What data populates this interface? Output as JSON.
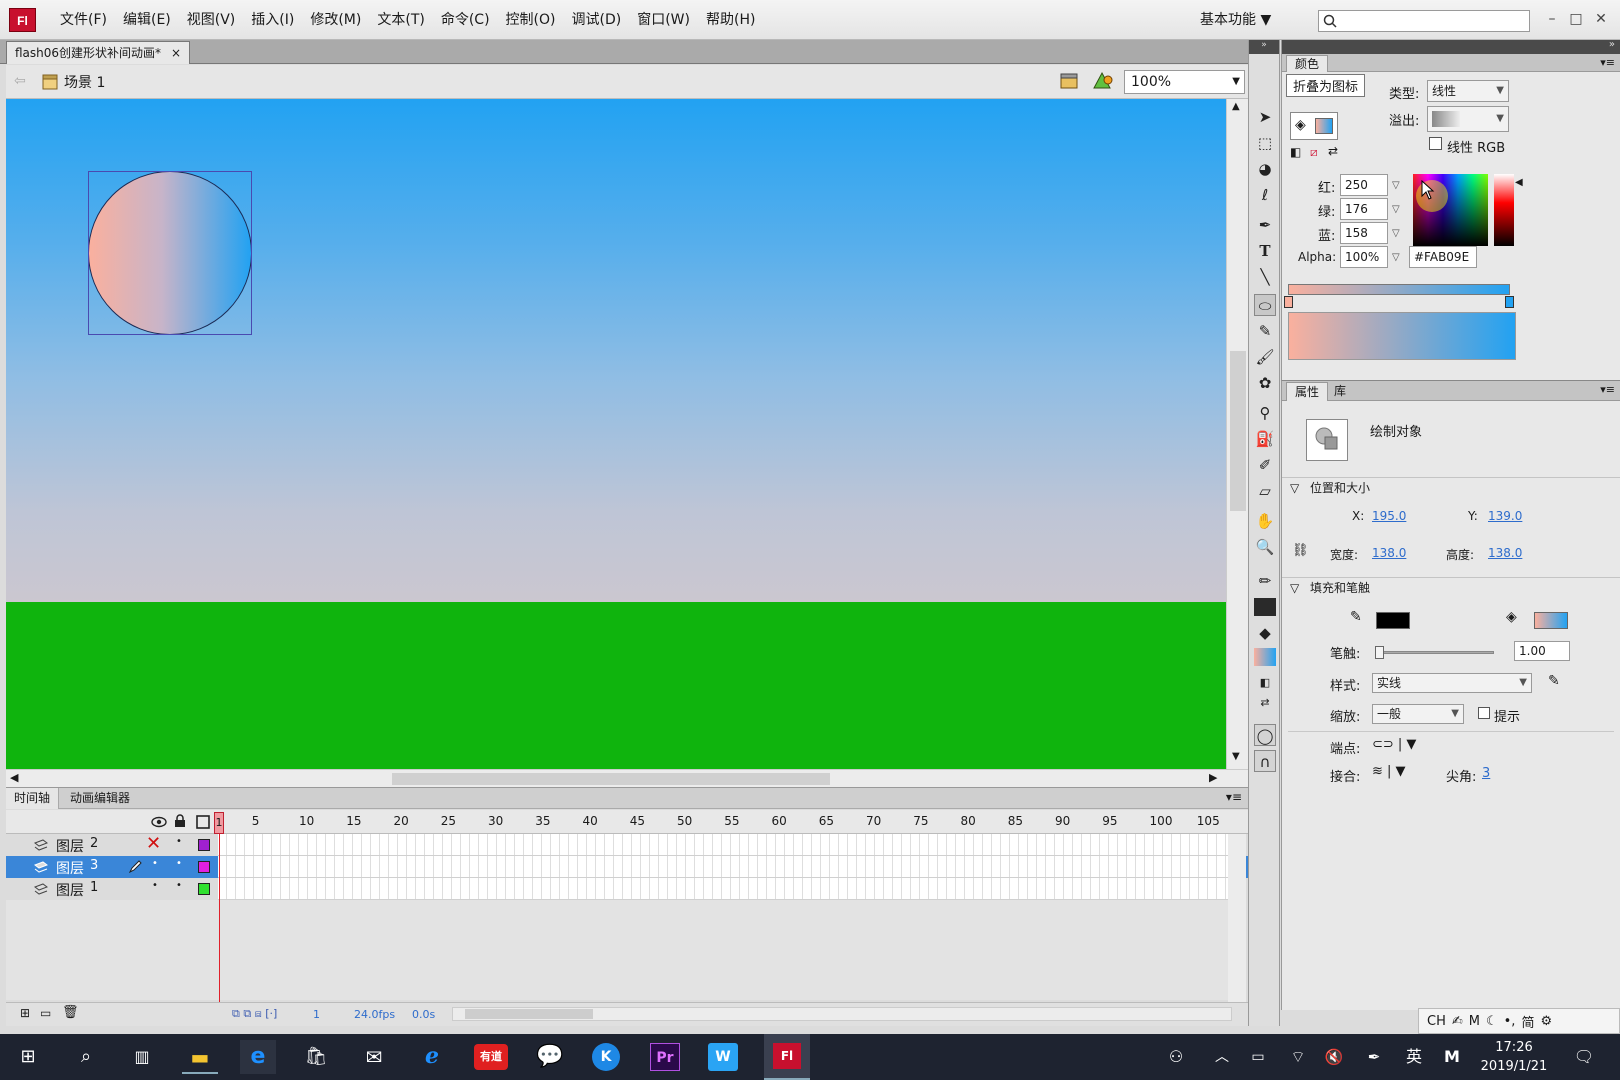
{
  "app": {
    "logo": "Fl"
  },
  "menu": [
    "文件(F)",
    "编辑(E)",
    "视图(V)",
    "插入(I)",
    "修改(M)",
    "文本(T)",
    "命令(C)",
    "控制(O)",
    "调试(D)",
    "窗口(W)",
    "帮助(H)"
  ],
  "workspace": "基本功能",
  "document": {
    "tab_title": "flash06创建形状补间动画*",
    "close": "×"
  },
  "editbar": {
    "scene": "场景 1",
    "zoom": "100%"
  },
  "colors": {
    "sky_top": "#22a2f2",
    "grass": "#0fb40d",
    "gradient_start": "#fab09e",
    "gradient_end": "#22a2f2"
  },
  "timeline": {
    "tabs": [
      "时间轴",
      "动画编辑器"
    ],
    "frame_numbers": [
      "1",
      "5",
      "10",
      "15",
      "20",
      "25",
      "30",
      "35",
      "40",
      "45",
      "50",
      "55",
      "60",
      "65",
      "70",
      "75",
      "80",
      "85",
      "90",
      "95",
      "100",
      "105"
    ],
    "layers": [
      {
        "name": "图层",
        "num": "2",
        "color": "#a020d0",
        "selected": false,
        "hidden": true
      },
      {
        "name": "图层",
        "num": "3",
        "color": "#e020e0",
        "selected": true,
        "hidden": false
      },
      {
        "name": "图层",
        "num": "1",
        "color": "#30e030",
        "selected": false,
        "hidden": false
      }
    ],
    "status": {
      "frame": "1",
      "fps": "24.0fps",
      "time": "0.0s"
    }
  },
  "color_panel": {
    "tab": "颜色",
    "tooltip": "折叠为图标",
    "type_label": "类型:",
    "type_value": "线性",
    "overflow_label": "溢出:",
    "linear_rgb": "线性 RGB",
    "red_label": "红:",
    "red": "250",
    "green_label": "绿:",
    "green": "176",
    "blue_label": "蓝:",
    "blue": "158",
    "alpha_label": "Alpha:",
    "alpha": "100%",
    "hex": "#FAB09E"
  },
  "properties": {
    "tabs": [
      "属性",
      "库"
    ],
    "object_type": "绘制对象",
    "pos_section": "位置和大小",
    "x_label": "X:",
    "x": "195.0",
    "y_label": "Y:",
    "y": "139.0",
    "w_label": "宽度:",
    "w": "138.0",
    "h_label": "高度:",
    "h": "138.0",
    "fill_section": "填充和笔触",
    "stroke_label": "笔触:",
    "stroke_value": "1.00",
    "style_label": "样式:",
    "style_value": "实线",
    "scale_label": "缩放:",
    "scale_value": "一般",
    "hint_label": "提示",
    "cap_label": "端点:",
    "join_label": "接合:",
    "miter_label": "尖角:",
    "miter_value": "3"
  },
  "ime": [
    "CH",
    "简"
  ],
  "taskbar": {
    "time": "17:26",
    "date": "2019/1/21",
    "lang": "英",
    "youdao": "有道"
  }
}
